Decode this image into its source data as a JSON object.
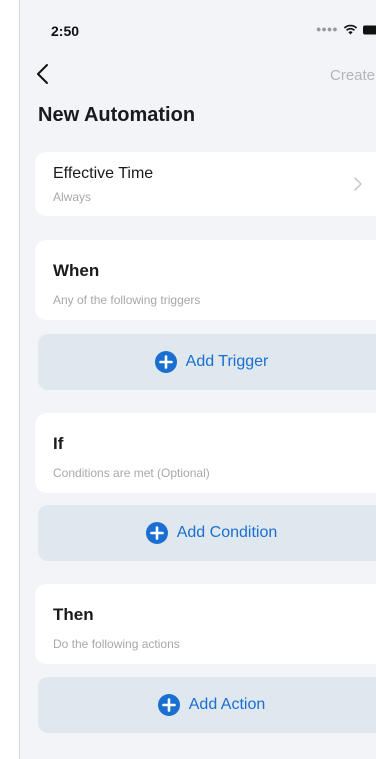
{
  "status_bar": {
    "time": "2:50",
    "icons": [
      "signal-dots-icon",
      "wifi-icon",
      "battery-icon"
    ]
  },
  "nav": {
    "back_icon": "chevron-left-icon",
    "create_label": "Create"
  },
  "page": {
    "title": "New Automation"
  },
  "effective_time": {
    "label": "Effective Time",
    "value": "Always",
    "icon": "chevron-right-icon"
  },
  "sections": {
    "when": {
      "title": "When",
      "subtitle": "Any of the following triggers",
      "button_label": "Add Trigger"
    },
    "if": {
      "title": "If",
      "subtitle": "Conditions are met (Optional)",
      "button_label": "Add Condition"
    },
    "then": {
      "title": "Then",
      "subtitle": "Do the following actions",
      "button_label": "Add Action"
    }
  },
  "colors": {
    "accent": "#1a6fd1",
    "button_bg": "#dfe7ef",
    "page_bg": "#f3f4f7",
    "muted_text": "#a8a8ac"
  }
}
